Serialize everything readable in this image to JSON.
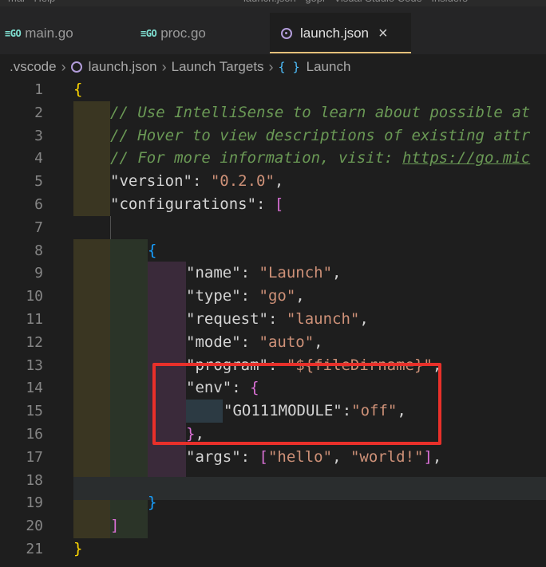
{
  "tabs": [
    {
      "icon": "GO",
      "label": "main.go"
    },
    {
      "icon": "GO",
      "label": "proc.go"
    },
    {
      "icon": "json",
      "label": "launch.json",
      "close": "×"
    }
  ],
  "breadcrumb": [
    ".vscode",
    "launch.json",
    "Launch Targets",
    "Launch"
  ],
  "breadcrumb_icons": {
    "launch_targets_icon": "{ }"
  },
  "line_numbers": [
    "1",
    "2",
    "3",
    "4",
    "5",
    "6",
    "7",
    "8",
    "9",
    "10",
    "11",
    "12",
    "13",
    "14",
    "15",
    "16",
    "17",
    "18",
    "19",
    "20",
    "21"
  ],
  "code": {
    "l1": "{",
    "l2": "// Use IntelliSense to learn about possible at",
    "l3": "// Hover to view descriptions of existing attr",
    "l4_pre": "// For more information, visit: ",
    "l4_link": "https://go.mic",
    "l5_key": "\"version\"",
    "l5_val": "\"0.2.0\"",
    "l6_key": "\"configurations\"",
    "l8": "{",
    "l9_key": "\"name\"",
    "l9_val": "\"Launch\"",
    "l10_key": "\"type\"",
    "l10_val": "\"go\"",
    "l11_key": "\"request\"",
    "l11_val": "\"launch\"",
    "l12_key": "\"mode\"",
    "l12_val": "\"auto\"",
    "l13_key": "\"program\"",
    "l13_val": "\"${fileDirname}\"",
    "l14_key": "\"env\"",
    "l15_key": "\"GO111MODULE\"",
    "l15_val": "\"off\"",
    "l17_key": "\"args\"",
    "l17_v1": "\"hello\"",
    "l17_v2": "\"world!\"",
    "l19": "}",
    "l20": "]",
    "l21": "}"
  }
}
